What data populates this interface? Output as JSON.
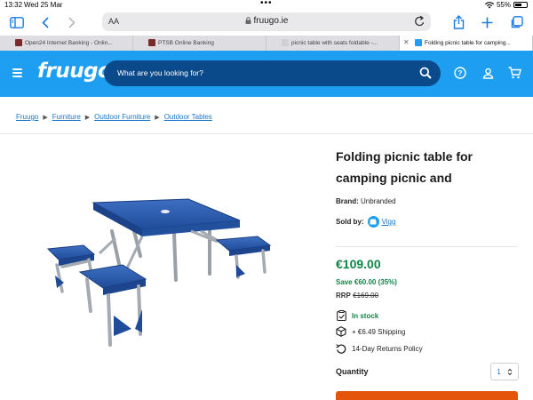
{
  "status_bar": {
    "time": "13:32",
    "date": "Wed 25 Mar",
    "battery": "55%",
    "battery_level": 0.55
  },
  "browser": {
    "aa_label": "AA",
    "url": "fruugo.ie",
    "tabs": [
      {
        "label": "Open24 Internet Banking - Onlin...",
        "favicon_color": "#7a2a2a",
        "active": false
      },
      {
        "label": "PTSB Online Banking",
        "favicon_color": "#7a2a2a",
        "active": false
      },
      {
        "label": "picnic table with seats foldable -...",
        "favicon_color": "#d0d0d0",
        "active": false
      },
      {
        "label": "Folding picnic table for camping...",
        "favicon_color": "#1d9ef0",
        "active": true
      }
    ],
    "tab_close": "✕"
  },
  "header": {
    "logo": "fruugo",
    "search_placeholder": "What are you looking for?",
    "brand_color": "#1d9ef0",
    "search_bg": "#0b4a8a"
  },
  "breadcrumb": [
    "Fruugo",
    "Furniture",
    "Outdoor Furniture",
    "Outdoor Tables"
  ],
  "product": {
    "title": "Folding picnic table for camping picnic and",
    "brand_label": "Brand:",
    "brand": "Unbranded",
    "sold_by_label": "Sold by:",
    "seller": "Vigg",
    "price": "€109.00",
    "save": "Save €60.00 (35%)",
    "rrp_label": "RRP",
    "rrp": "€169.00",
    "stock": "In stock",
    "shipping": "+ €6.49 Shipping",
    "returns": "14-Day Returns Policy",
    "quantity_label": "Quantity",
    "quantity": "1"
  },
  "colors": {
    "price_green": "#118447",
    "link_blue": "#1976c9",
    "cta_orange": "#e4550b"
  }
}
